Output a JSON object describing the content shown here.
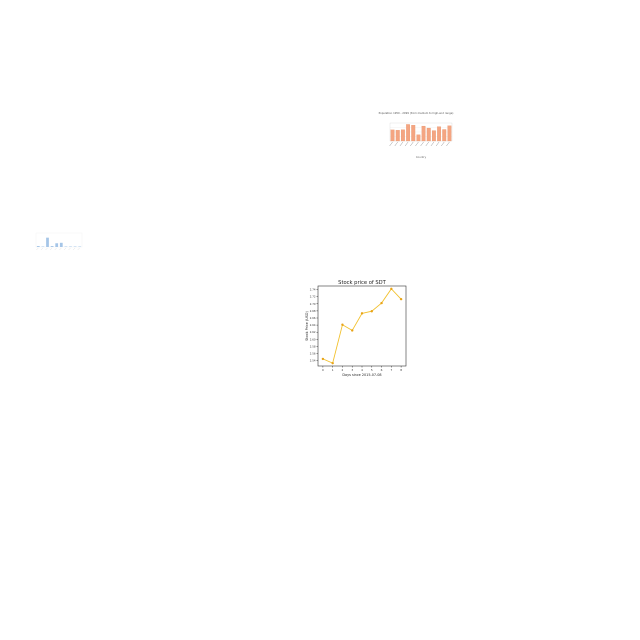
{
  "chart_data": [
    {
      "id": "bar-orange",
      "type": "bar",
      "title": "Population 1950 - 2099 (from medium to high-end range)",
      "subtitle": "",
      "xlabel": "Country",
      "ylabel": "",
      "categories": [
        "",
        "",
        "",
        "",
        "",
        "",
        "",
        "",
        "",
        "",
        "",
        ""
      ],
      "values": [
        62,
        60,
        63,
        92,
        88,
        35,
        83,
        72,
        58,
        80,
        64,
        85
      ],
      "ylim": [
        0,
        100
      ],
      "grid": true,
      "colors": {
        "bar": "#f4a582",
        "edge": "#e08050"
      }
    },
    {
      "id": "bar-blue",
      "type": "bar",
      "title": "",
      "xlabel": "",
      "ylabel": "",
      "categories": [
        "",
        "",
        "",
        "",
        "",
        "",
        "",
        "",
        "",
        ""
      ],
      "values": [
        2,
        1,
        20,
        2,
        8,
        9,
        1,
        1,
        1,
        1
      ],
      "ylim": [
        0,
        30
      ],
      "grid": true,
      "colors": {
        "bar": "#6a9fd8"
      }
    },
    {
      "id": "line-sdt",
      "type": "line",
      "title": "Stock price of SDT",
      "xlabel": "Days since 2015-07-08",
      "ylabel": "Stock Price (USD)",
      "x": [
        0,
        1,
        2,
        3,
        4,
        5,
        6,
        7,
        8
      ],
      "y": [
        2.545,
        2.533,
        2.641,
        2.625,
        2.673,
        2.679,
        2.702,
        2.742,
        2.713
      ],
      "xticks": [
        "0",
        "1",
        "2",
        "3",
        "4",
        "5",
        "6",
        "7",
        "8"
      ],
      "yticks": [
        "2.54",
        "2.56",
        "2.58",
        "2.60",
        "2.62",
        "2.64",
        "2.66",
        "2.68",
        "2.70",
        "2.72",
        "2.74"
      ],
      "xlim": [
        -0.5,
        8.5
      ],
      "ylim": [
        2.525,
        2.75
      ],
      "grid": false,
      "colors": {
        "line": "#f2c12e",
        "marker": "#e8a317"
      }
    }
  ]
}
